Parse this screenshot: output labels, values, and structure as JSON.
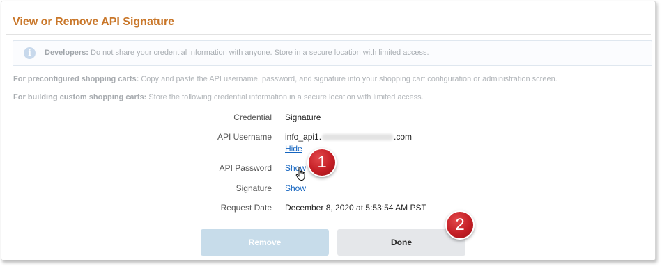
{
  "dialog": {
    "title": "View or Remove API Signature",
    "notice": {
      "label": "Developers:",
      "text": " Do not share your credential information with anyone. Store in a secure location with limited access."
    },
    "para_preconfigured": {
      "label": "For preconfigured shopping carts:",
      "text": " Copy and paste the API username, password, and signature into your shopping cart configuration or administration screen."
    },
    "para_custom": {
      "label": "For building custom shopping carts:",
      "text": " Store the following credential information in a secure location with limited access."
    }
  },
  "credentials": {
    "credential_label": "Credential",
    "credential_value": "Signature",
    "username_label": "API Username",
    "username_prefix": "info_api1.",
    "username_suffix": ".com",
    "hide_link": "Hide",
    "password_label": "API Password",
    "password_link": "Show",
    "signature_label": "Signature",
    "signature_link": "Show",
    "request_date_label": "Request Date",
    "request_date_value": "December 8, 2020 at 5:53:54 AM PST"
  },
  "buttons": {
    "remove": "Remove",
    "done": "Done"
  },
  "annotations": {
    "badge_1": "1",
    "badge_2": "2"
  },
  "colors": {
    "title": "#c9772a",
    "link": "#1565c0",
    "badge": "#c41e25",
    "remove_button": "#c7dcea",
    "done_button": "#e5e7ea"
  }
}
